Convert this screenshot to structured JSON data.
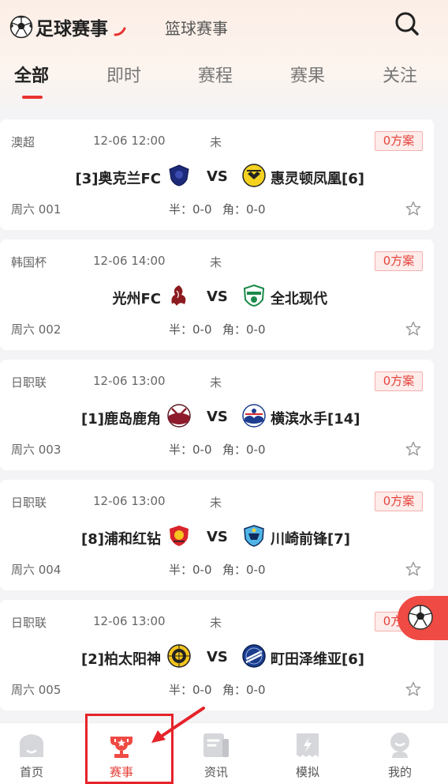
{
  "header": {
    "sport_tabs": [
      {
        "label": "足球赛事",
        "active": true
      },
      {
        "label": "篮球赛事",
        "active": false
      }
    ],
    "search_icon": "search-icon",
    "categories": [
      {
        "label": "全部",
        "active": true
      },
      {
        "label": "即时",
        "active": false
      },
      {
        "label": "赛程",
        "active": false
      },
      {
        "label": "赛果",
        "active": false
      },
      {
        "label": "关注",
        "active": false
      }
    ]
  },
  "matches": [
    {
      "league": "澳超",
      "time": "12-06 12:00",
      "status": "未",
      "plans": "0方案",
      "home": "[3]奥克兰FC",
      "vs": "VS",
      "away": "惠灵顿凤凰[6]",
      "match_no": "周六 001",
      "half": "半：0-0",
      "corner": "角：0-0"
    },
    {
      "league": "韩国杯",
      "time": "12-06 14:00",
      "status": "未",
      "plans": "0方案",
      "home": "光州FC",
      "vs": "VS",
      "away": "全北现代",
      "match_no": "周六 002",
      "half": "半：0-0",
      "corner": "角：0-0"
    },
    {
      "league": "日职联",
      "time": "12-06 13:00",
      "status": "未",
      "plans": "0方案",
      "home": "[1]鹿岛鹿角",
      "vs": "VS",
      "away": "横滨水手[14]",
      "match_no": "周六 003",
      "half": "半：0-0",
      "corner": "角：0-0"
    },
    {
      "league": "日职联",
      "time": "12-06 13:00",
      "status": "未",
      "plans": "0方案",
      "home": "[8]浦和红钻",
      "vs": "VS",
      "away": "川崎前锋[7]",
      "match_no": "周六 004",
      "half": "半：0-0",
      "corner": "角：0-0"
    },
    {
      "league": "日职联",
      "time": "12-06 13:00",
      "status": "未",
      "plans": "0方案",
      "home": "[2]柏太阳神",
      "vs": "VS",
      "away": "町田泽维亚[6]",
      "match_no": "周六 005",
      "half": "半：0-0",
      "corner": "角：0-0"
    }
  ],
  "tabbar": [
    {
      "label": "首页",
      "icon": "home-icon",
      "active": false
    },
    {
      "label": "赛事",
      "icon": "trophy-icon",
      "active": true
    },
    {
      "label": "资讯",
      "icon": "news-icon",
      "active": false
    },
    {
      "label": "模拟",
      "icon": "ticket-icon",
      "active": false
    },
    {
      "label": "我的",
      "icon": "profile-icon",
      "active": false
    }
  ],
  "colors": {
    "accent": "#e5423b",
    "highlight": "#e5232a"
  }
}
